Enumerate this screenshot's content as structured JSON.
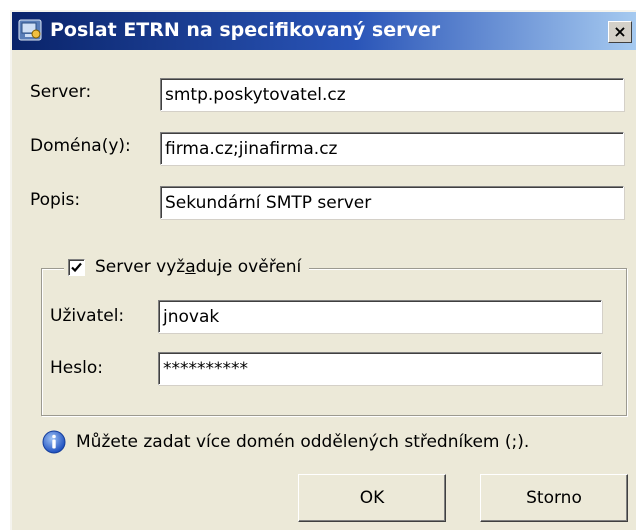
{
  "window": {
    "title": "Poslat ETRN na specifikovaný server",
    "close_glyph": "×"
  },
  "form": {
    "server_label": "Server:",
    "server_value": "smtp.poskytovatel.cz",
    "domains_label": "Doména(y):",
    "domains_value": "firma.cz;jinafirma.cz",
    "description_label": "Popis:",
    "description_value": "Sekundární SMTP server"
  },
  "auth": {
    "checkbox_label_pre": "Server vyž",
    "checkbox_label_mnemonic": "a",
    "checkbox_label_post": "duje ověření",
    "checked": true,
    "user_label": "Uživatel:",
    "user_value": "jnovak",
    "password_label": "Heslo:",
    "password_value": "**********"
  },
  "info": {
    "icon": "info-icon",
    "text": "Můžete zadat více domén oddělených středníkem (;)."
  },
  "buttons": {
    "ok_label": "OK",
    "cancel_label": "Storno"
  },
  "colors": {
    "title_start": "#0a246a",
    "title_end": "#a6caf0",
    "dialog_bg": "#ece9d8"
  }
}
